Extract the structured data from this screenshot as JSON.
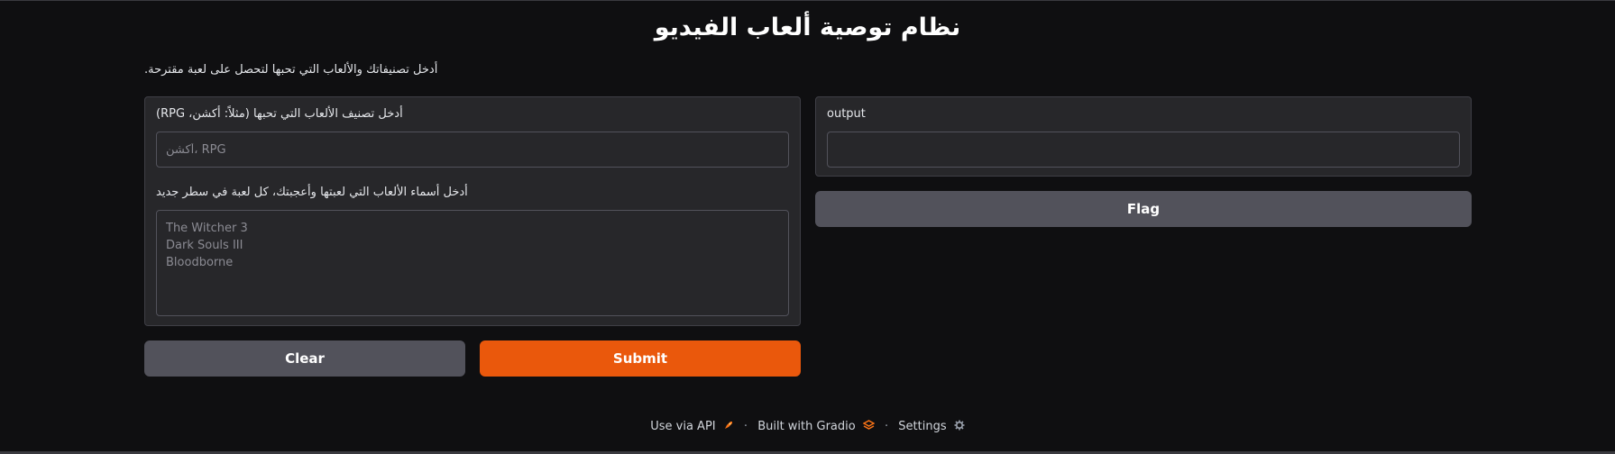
{
  "header": {
    "title": "نظام توصية ألعاب الفيديو",
    "description": "أدخل تصنيفاتك والألعاب التي تحبها لتحصل على لعبة مقترحة."
  },
  "inputs": {
    "genre": {
      "label": "أدخل تصنيف الألعاب التي تحبها (مثلاً: أكشن، RPG)",
      "placeholder": "أكشن، RPG",
      "value": ""
    },
    "games": {
      "label": "أدخل أسماء الألعاب التي لعبتها وأعجبتك، كل لعبة في سطر جديد",
      "placeholder": "The Witcher 3\nDark Souls III\nBloodborne",
      "value": ""
    }
  },
  "output": {
    "label": "output",
    "value": ""
  },
  "buttons": {
    "clear": "Clear",
    "submit": "Submit",
    "flag": "Flag"
  },
  "footer": {
    "api": "Use via API",
    "api_icon": "rocket-icon",
    "built": "Built with Gradio",
    "built_icon": "gradio-logo-icon",
    "settings": "Settings",
    "settings_icon": "gear-icon",
    "separator": "·"
  },
  "colors": {
    "background": "#0f0f11",
    "panel": "#27272a",
    "primary": "#ea580c",
    "secondary": "#52525b"
  }
}
